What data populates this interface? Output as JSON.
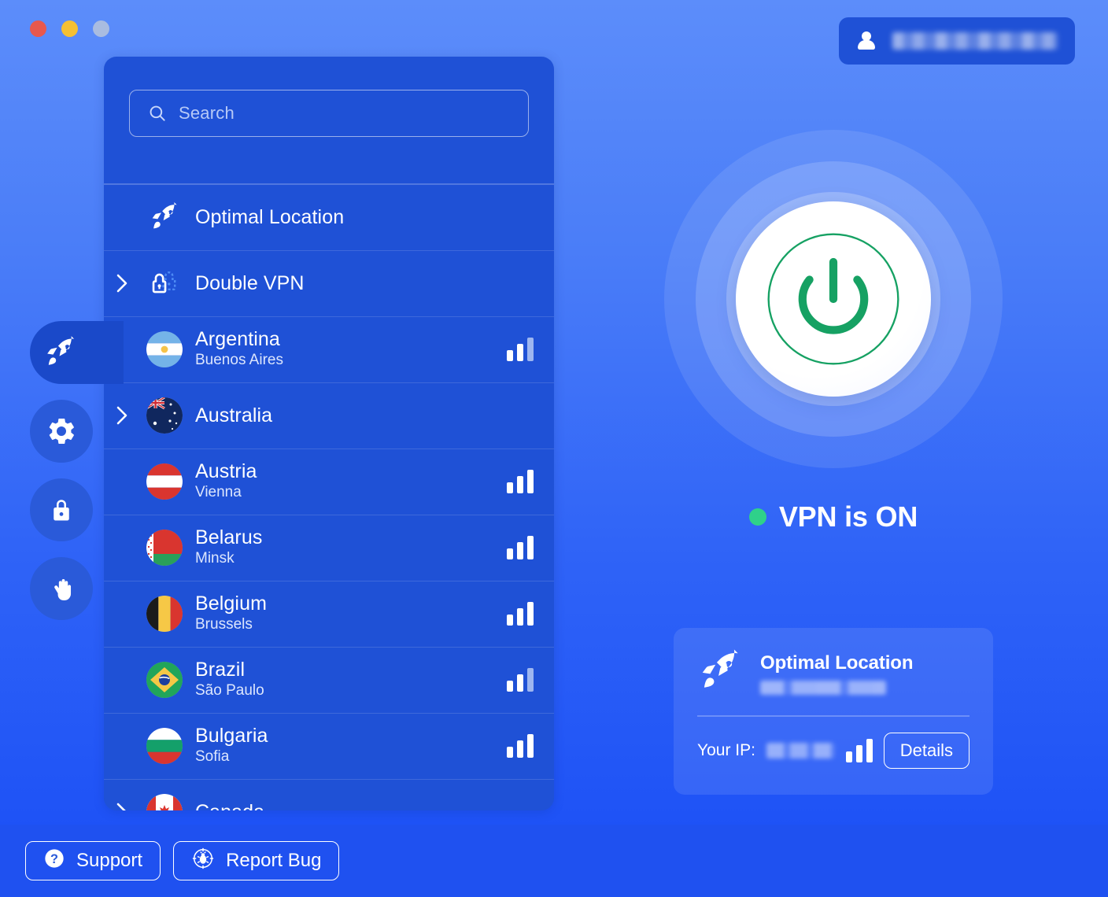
{
  "window": {
    "traffic_lights": [
      {
        "name": "close",
        "color": "#e8584d"
      },
      {
        "name": "minimize",
        "color": "#f5c033"
      },
      {
        "name": "zoom",
        "color": "#a9bce0"
      }
    ]
  },
  "account": {
    "icon": "person-icon",
    "username_blurred": true,
    "username": ""
  },
  "rail": {
    "items": [
      {
        "icon": "rocket-icon",
        "name": "locations",
        "active": true
      },
      {
        "icon": "gear-icon",
        "name": "settings",
        "active": false
      },
      {
        "icon": "lock-icon",
        "name": "security",
        "active": false
      },
      {
        "icon": "hand-icon",
        "name": "blocker",
        "active": false
      }
    ]
  },
  "search": {
    "icon": "search-icon",
    "placeholder": "Search",
    "value": ""
  },
  "locations": [
    {
      "id": "optimal-location",
      "title": "Optimal Location",
      "subtitle": "",
      "icon": "rocket-icon",
      "expandable": false,
      "signal": null
    },
    {
      "id": "double-vpn",
      "title": "Double VPN",
      "subtitle": "",
      "icon": "double-lock-icon",
      "expandable": true,
      "signal": null
    },
    {
      "id": "argentina",
      "title": "Argentina",
      "subtitle": "Buenos Aires",
      "icon": "flag-argentina",
      "expandable": false,
      "signal": {
        "bars": 3,
        "dim_last": true
      }
    },
    {
      "id": "australia",
      "title": "Australia",
      "subtitle": "",
      "icon": "flag-australia",
      "expandable": true,
      "signal": null
    },
    {
      "id": "austria",
      "title": "Austria",
      "subtitle": "Vienna",
      "icon": "flag-austria",
      "expandable": false,
      "signal": {
        "bars": 3,
        "dim_last": false
      }
    },
    {
      "id": "belarus",
      "title": "Belarus",
      "subtitle": "Minsk",
      "icon": "flag-belarus",
      "expandable": false,
      "signal": {
        "bars": 3,
        "dim_last": false
      }
    },
    {
      "id": "belgium",
      "title": "Belgium",
      "subtitle": "Brussels",
      "icon": "flag-belgium",
      "expandable": false,
      "signal": {
        "bars": 3,
        "dim_last": false
      }
    },
    {
      "id": "brazil",
      "title": "Brazil",
      "subtitle": "São Paulo",
      "icon": "flag-brazil",
      "expandable": false,
      "signal": {
        "bars": 3,
        "dim_last": true
      }
    },
    {
      "id": "bulgaria",
      "title": "Bulgaria",
      "subtitle": "Sofia",
      "icon": "flag-bulgaria",
      "expandable": false,
      "signal": {
        "bars": 3,
        "dim_last": false
      }
    },
    {
      "id": "canada",
      "title": "Canada",
      "subtitle": "",
      "icon": "flag-canada",
      "expandable": true,
      "signal": null
    }
  ],
  "connection": {
    "power_button_label": "power-button",
    "status_text": "VPN is ON",
    "status_color": "#2fd18a",
    "power_icon_color": "#16a163"
  },
  "info_card": {
    "icon": "rocket-icon",
    "title": "Optimal Location",
    "subtitle_blurred": true,
    "subtitle": "",
    "ip_label": "Your IP:",
    "ip_blurred": true,
    "ip_value": "",
    "signal": {
      "bars": 3,
      "dim_last": false
    },
    "details_label": "Details"
  },
  "bottom_bar": {
    "support_label": "Support",
    "support_icon": "question-circle-icon",
    "report_bug_label": "Report Bug",
    "report_bug_icon": "bug-target-icon"
  }
}
